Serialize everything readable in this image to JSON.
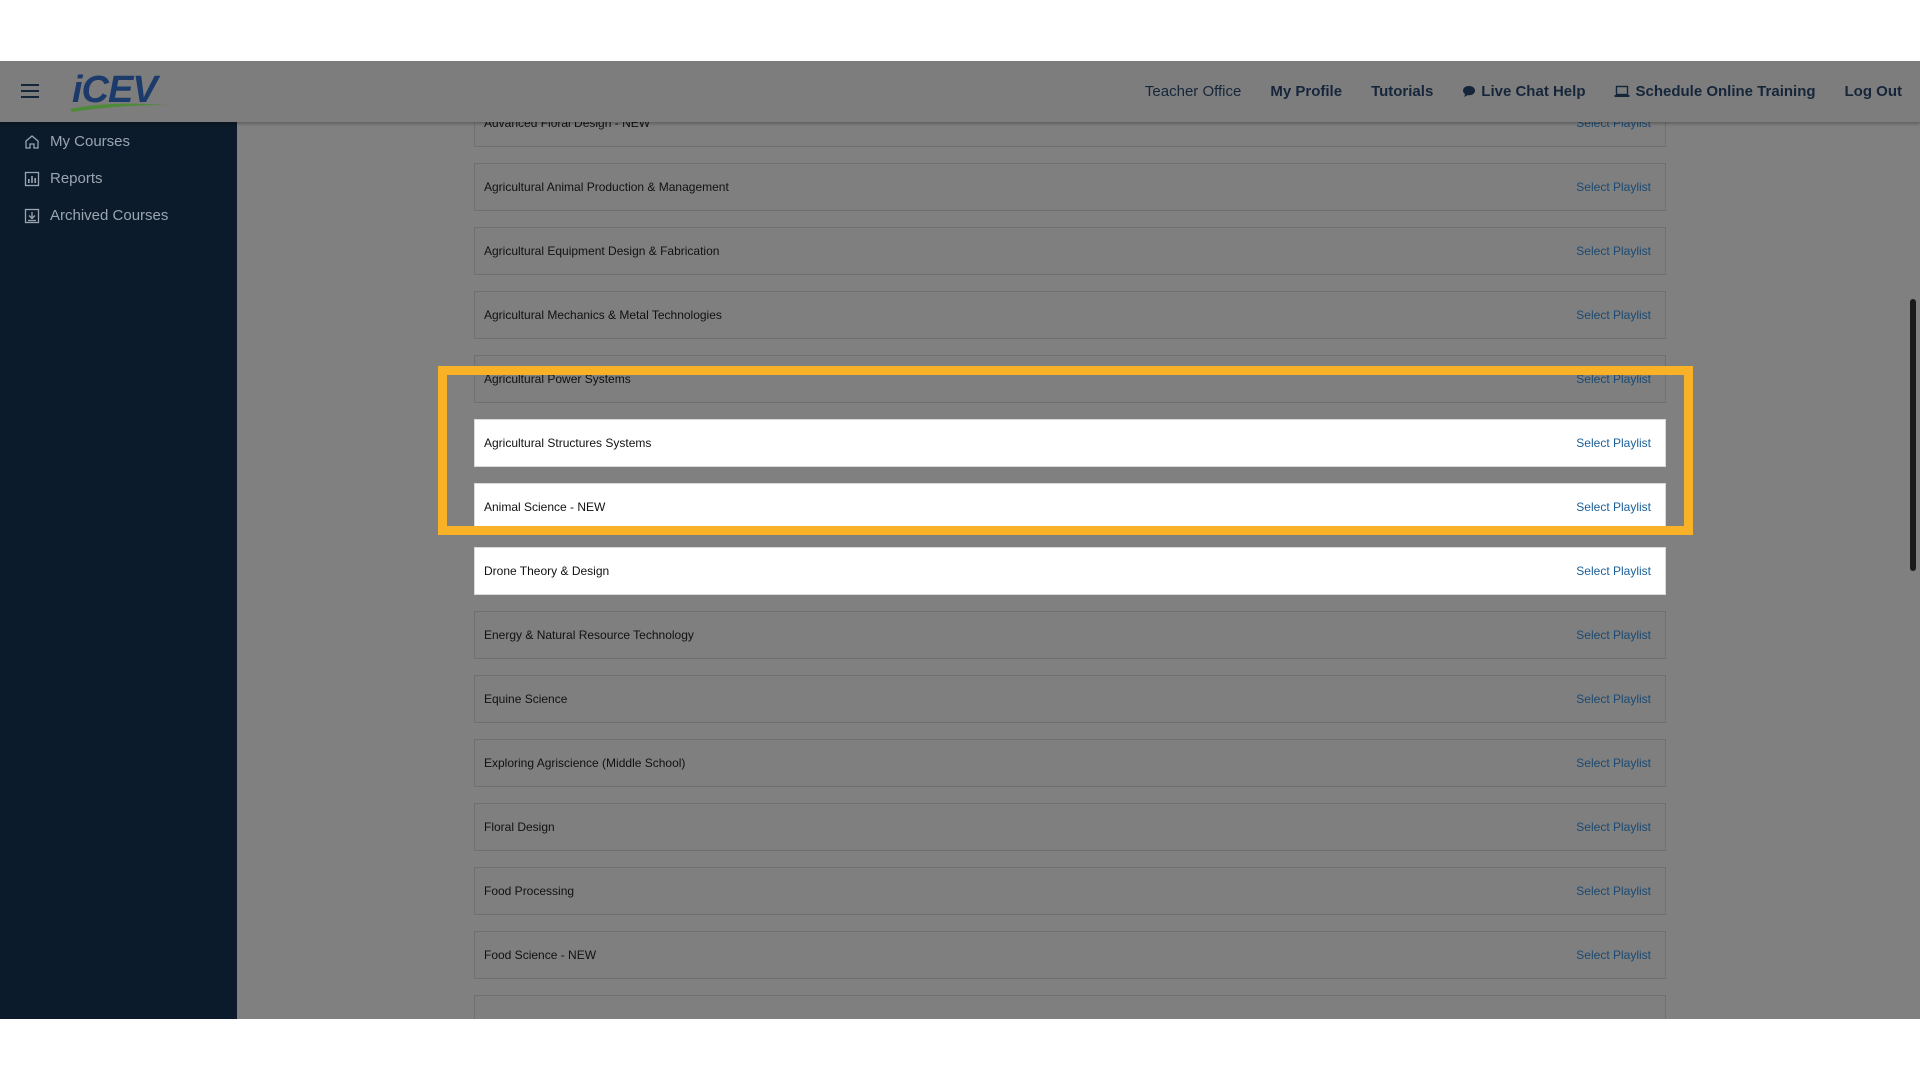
{
  "header": {
    "logo_text": "iCEV",
    "nav": [
      {
        "label": "Teacher Office",
        "weight": "plain"
      },
      {
        "label": "My Profile",
        "weight": "bold"
      },
      {
        "label": "Tutorials",
        "weight": "bold"
      },
      {
        "label": "Live Chat Help",
        "weight": "bold",
        "icon": "chat-icon"
      },
      {
        "label": "Schedule Online Training",
        "weight": "bold",
        "icon": "laptop-icon"
      },
      {
        "label": "Log Out",
        "weight": "bold"
      }
    ]
  },
  "sidebar": {
    "items": [
      {
        "label": "My Courses",
        "icon": "home-icon"
      },
      {
        "label": "Reports",
        "icon": "chart-icon"
      },
      {
        "label": "Archived Courses",
        "icon": "archive-icon"
      }
    ]
  },
  "courses": {
    "link_label": "Select Playlist",
    "rows": [
      {
        "title": "Advanced Floral Design - NEW",
        "highlighted": false
      },
      {
        "title": "Agricultural Animal Production & Management",
        "highlighted": false
      },
      {
        "title": "Agricultural Equipment Design & Fabrication",
        "highlighted": false
      },
      {
        "title": "Agricultural Mechanics & Metal Technologies",
        "highlighted": false
      },
      {
        "title": "Agricultural Power Systems",
        "highlighted": false
      },
      {
        "title": "Agricultural Structures Systems",
        "highlighted": true
      },
      {
        "title": "Animal Science - NEW",
        "highlighted": true
      },
      {
        "title": "Drone Theory & Design",
        "highlighted": true
      },
      {
        "title": "Energy & Natural Resource Technology",
        "highlighted": false
      },
      {
        "title": "Equine Science",
        "highlighted": false
      },
      {
        "title": "Exploring Agriscience (Middle School)",
        "highlighted": false
      },
      {
        "title": "Floral Design",
        "highlighted": false
      },
      {
        "title": "Food Processing",
        "highlighted": false
      },
      {
        "title": "Food Science - NEW",
        "highlighted": false
      },
      {
        "title": "",
        "highlighted": false
      }
    ]
  },
  "colors": {
    "highlight_border": "#f9b128",
    "sidebar_bg": "#0c1b2b",
    "overlay": "#808080"
  }
}
